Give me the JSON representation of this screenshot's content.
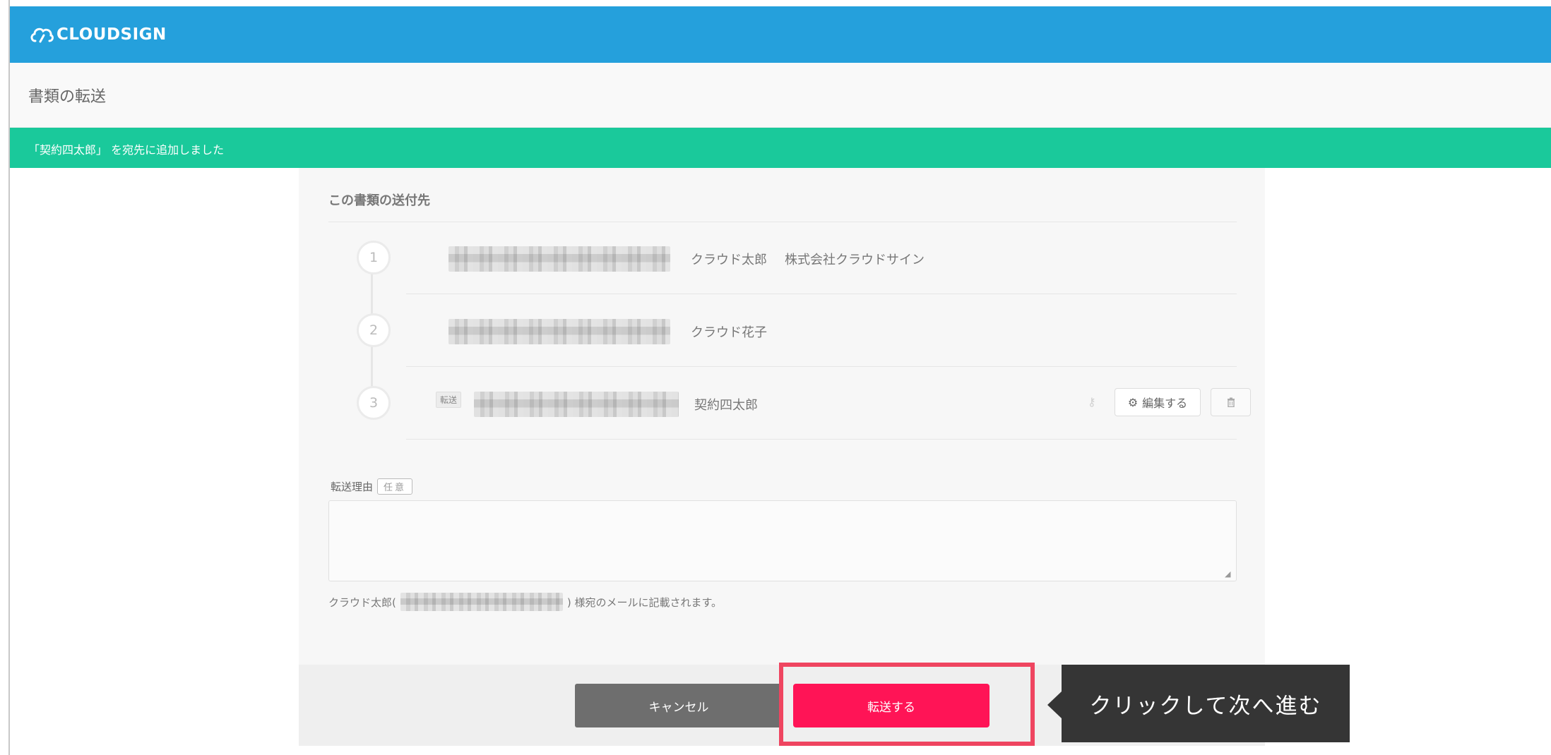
{
  "header": {
    "logo_text": "CLOUDSIGN",
    "brand_color": "#25a0dc"
  },
  "page": {
    "title": "書類の転送"
  },
  "notice": {
    "text": "「契約四太郎」 を宛先に追加しました",
    "color": "#1ac99b"
  },
  "recipients": {
    "title": "この書類の送付先",
    "items": [
      {
        "number": "1",
        "name": "クラウド太郎",
        "company": "株式会社クラウドサイン"
      },
      {
        "number": "2",
        "name": "クラウド花子",
        "company": ""
      },
      {
        "number": "3",
        "tag": "転送",
        "name": "契約四太郎",
        "company": "",
        "edit_label": "編集する"
      }
    ]
  },
  "reason": {
    "label": "転送理由",
    "optional": "任意",
    "value": "",
    "help_prefix": "クラウド太郎(",
    "help_suffix": ") 様宛のメールに記載されます。"
  },
  "actions": {
    "cancel_label": "キャンセル",
    "submit_label": "転送する",
    "submit_color": "#ff1456",
    "cancel_color": "#6e6e6e"
  },
  "tooltip": {
    "text": "クリックして次へ進む"
  }
}
